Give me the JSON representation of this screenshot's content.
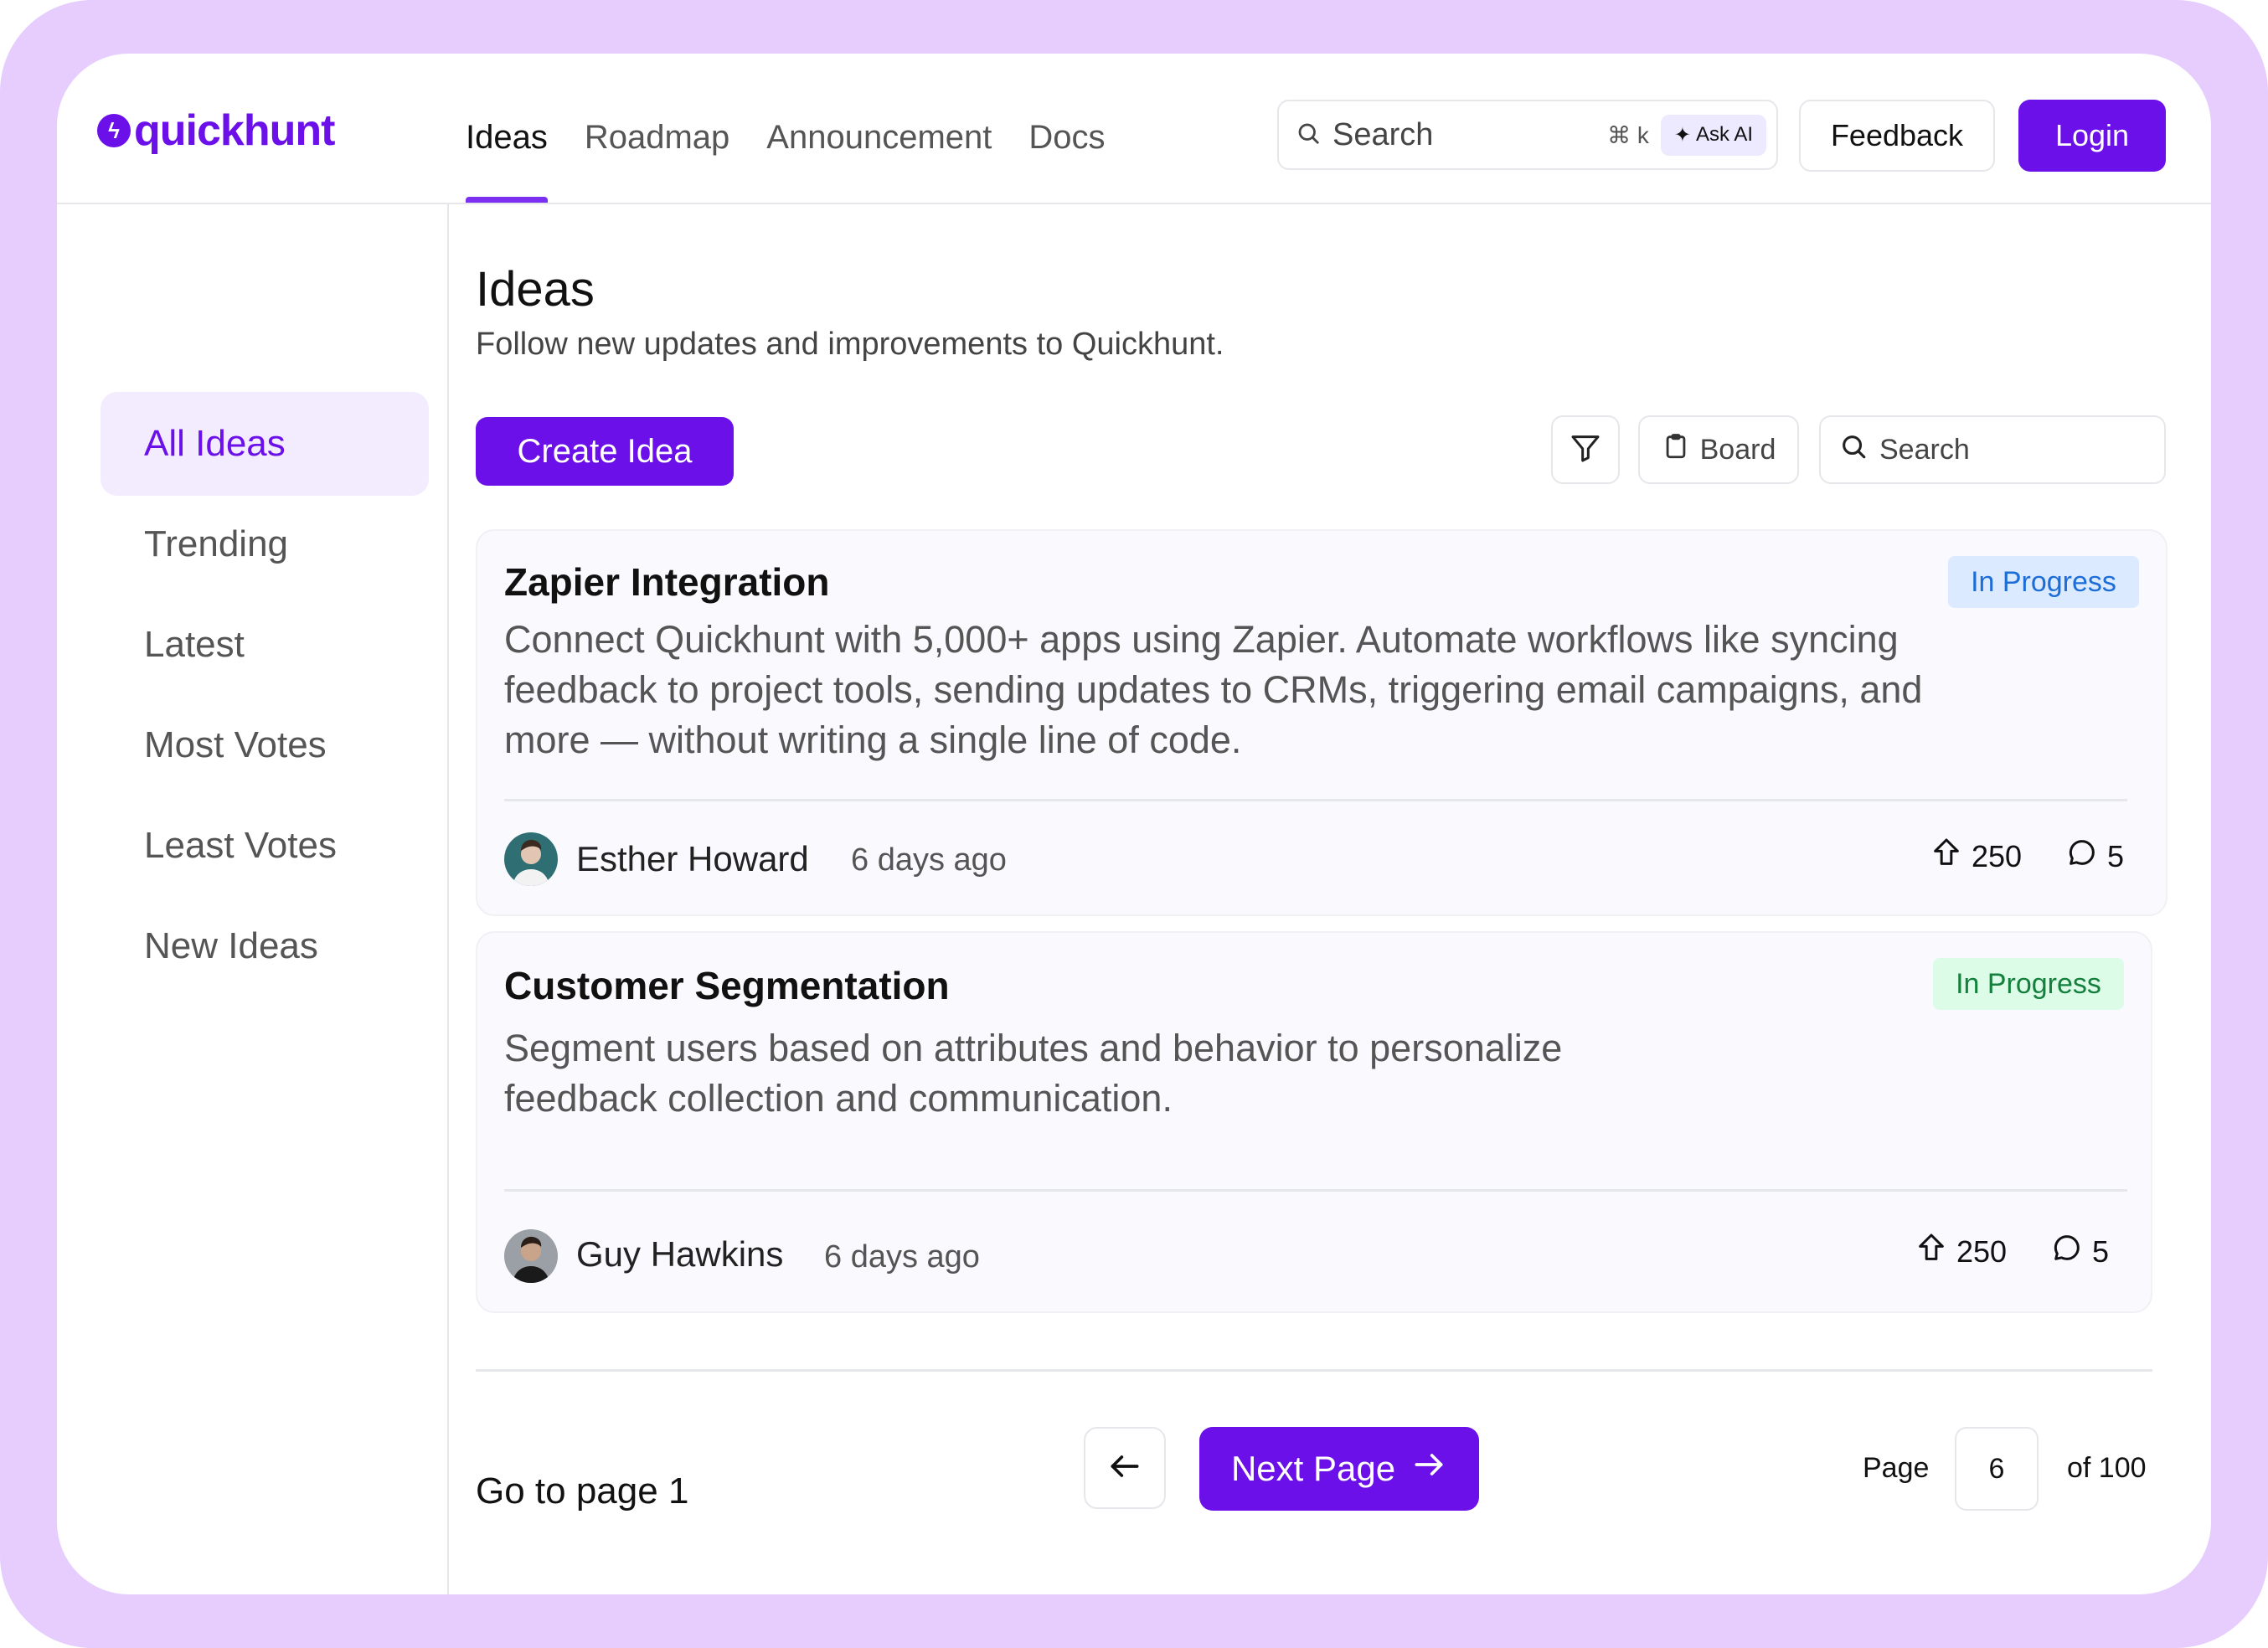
{
  "brand": {
    "name": "quickhunt",
    "color": "#6b10e8"
  },
  "nav": {
    "items": [
      {
        "label": "Ideas",
        "active": true
      },
      {
        "label": "Roadmap"
      },
      {
        "label": "Announcement"
      },
      {
        "label": "Docs"
      }
    ]
  },
  "header": {
    "search_placeholder": "Search",
    "search_shortcut": "⌘ k",
    "ask_ai_label": "Ask AI",
    "feedback_label": "Feedback",
    "login_label": "Login"
  },
  "sidebar": {
    "items": [
      {
        "label": "All Ideas",
        "active": true
      },
      {
        "label": "Trending"
      },
      {
        "label": "Latest"
      },
      {
        "label": "Most Votes"
      },
      {
        "label": "Least Votes"
      },
      {
        "label": "New Ideas"
      }
    ]
  },
  "main": {
    "title": "Ideas",
    "subtitle": "Follow new updates and improvements to Quickhunt.",
    "create_label": "Create Idea",
    "board_label": "Board",
    "search_placeholder": "Search"
  },
  "ideas": [
    {
      "title": "Zapier Integration",
      "status": "In Progress",
      "description": "Connect Quickhunt with 5,000+ apps using Zapier. Automate workflows like syncing feedback to project tools, sending updates to CRMs, triggering email campaigns, and more — without writing a single line of code.",
      "author": "Esther Howard",
      "time": "6 days ago",
      "votes": "250",
      "comments": "5"
    },
    {
      "title": "Customer Segmentation",
      "status": "In Progress",
      "description": "Segment users based on attributes and behavior to personalize feedback collection and communication.",
      "author": "Guy Hawkins",
      "time": "6 days ago",
      "votes": "250",
      "comments": "5"
    }
  ],
  "pagination": {
    "goto_label": "Go to page 1",
    "next_label": "Next Page",
    "page_label": "Page",
    "current_page": "6",
    "of_label": "of 100"
  }
}
